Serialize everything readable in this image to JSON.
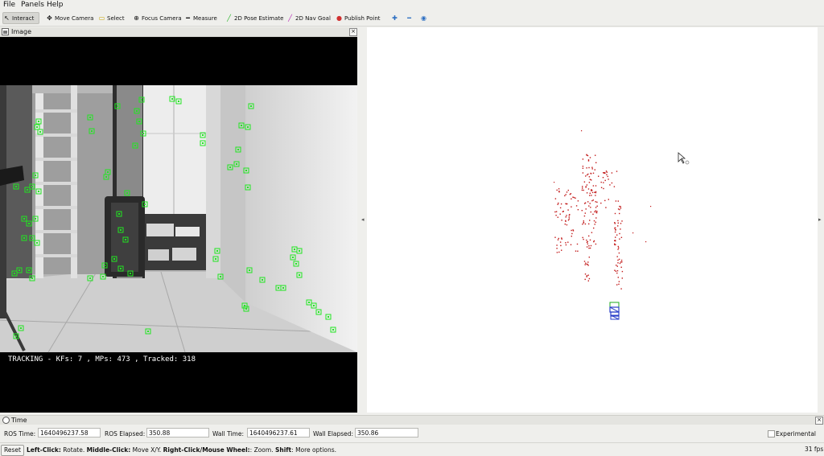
{
  "menu": {
    "file": "File",
    "panels": "Panels",
    "help": "Help"
  },
  "toolbar": {
    "interact": "Interact",
    "move_camera": "Move Camera",
    "select": "Select",
    "focus_camera": "Focus Camera",
    "measure": "Measure",
    "pose_estimate": "2D Pose Estimate",
    "nav_goal": "2D Nav Goal",
    "publish_point": "Publish Point"
  },
  "image_panel": {
    "title": "Image",
    "overlay_text": "TRACKING  - KFs: 7 , MPs: 473 , Tracked: 318"
  },
  "time_panel": {
    "title": "Time",
    "ros_time_label": "ROS Time:",
    "ros_time": "1640496237.58",
    "ros_elapsed_label": "ROS Elapsed:",
    "ros_elapsed": "350.88",
    "wall_time_label": "Wall Time:",
    "wall_time": "1640496237.61",
    "wall_elapsed_label": "Wall Elapsed:",
    "wall_elapsed": "350.86",
    "experimental_label": "Experimental"
  },
  "status": {
    "reset": "Reset",
    "left_click": "Left-Click:",
    "left_click_desc": " Rotate. ",
    "middle_click": "Middle-Click:",
    "middle_click_desc": " Move X/Y. ",
    "right_click": "Right-Click/Mouse Wheel:",
    "right_click_desc": ": Zoom. ",
    "shift": "Shift",
    "shift_desc": ": More options.",
    "fps": "31 fps"
  },
  "colors": {
    "feature_green": "#22e622",
    "point_red": "#c21a1a",
    "camera_blue": "#2a3fc8",
    "camera_green": "#1ea81e"
  }
}
